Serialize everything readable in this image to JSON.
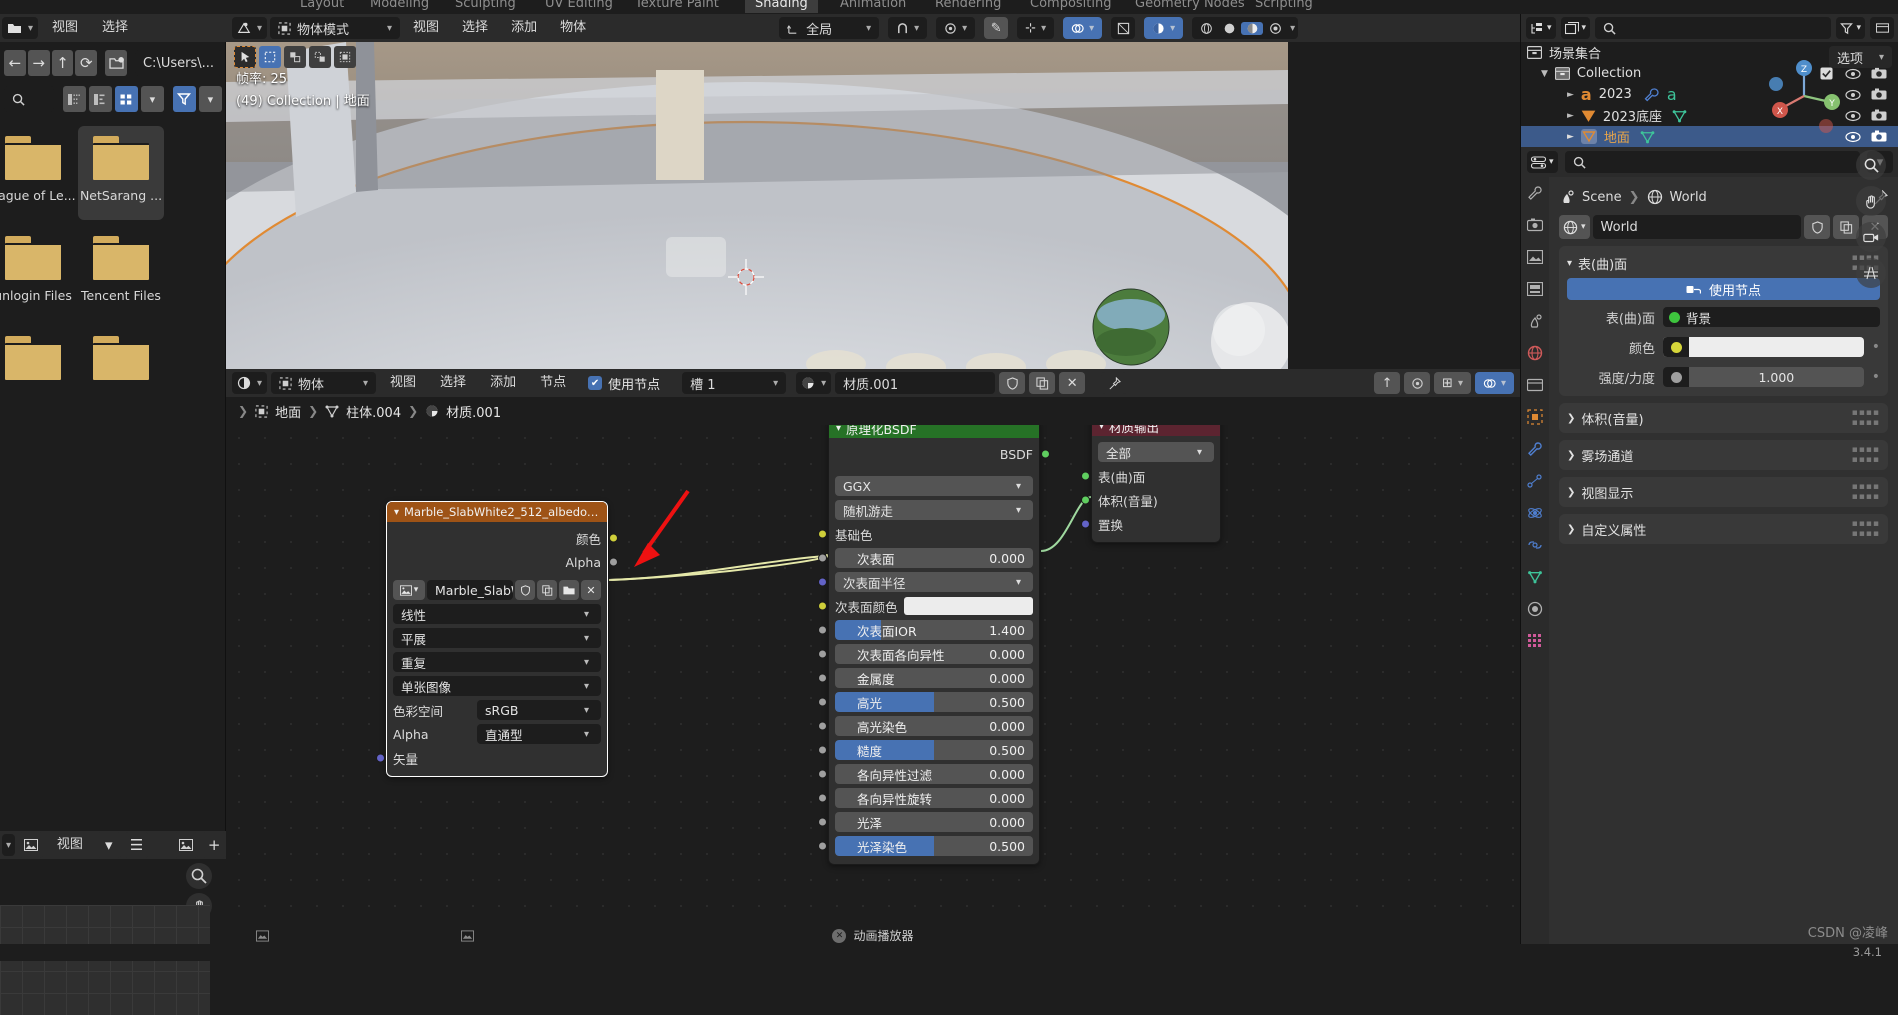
{
  "topbar": {
    "workspaces": [
      {
        "label": "Layout",
        "active": false
      },
      {
        "label": "Modeling",
        "active": false
      },
      {
        "label": "Sculpting",
        "active": false
      },
      {
        "label": "UV Editing",
        "active": false
      },
      {
        "label": "Texture Paint",
        "active": false
      },
      {
        "label": "Shading",
        "active": true
      },
      {
        "label": "Animation",
        "active": false
      },
      {
        "label": "Rendering",
        "active": false
      },
      {
        "label": "Compositing",
        "active": false
      },
      {
        "label": "Geometry Nodes",
        "active": false
      },
      {
        "label": "Scripting",
        "active": false
      }
    ]
  },
  "filebrowser": {
    "menus": [
      "视图",
      "选择"
    ],
    "path_value": "C:\\Users\\...",
    "search_placeholder": "",
    "icons": {
      "editor_type": "file-browser-icon",
      "back": "arrow-left-icon",
      "forward": "arrow-right-icon",
      "up": "arrow-up-icon",
      "refresh": "refresh-icon",
      "new_folder": "new-folder-icon",
      "search": "search-icon",
      "filter": "filter-icon",
      "display_list": "list-view-icon",
      "display_detail": "detail-view-icon",
      "display_thumbnail": "thumbnail-view-icon"
    },
    "items": [
      {
        "name": "eague of Le...",
        "selected": false
      },
      {
        "name": "NetSarang ...",
        "selected": true
      },
      {
        "name": "unlogin Files",
        "selected": false
      },
      {
        "name": "Tencent Files",
        "selected": false
      },
      {
        "name": "",
        "selected": false
      },
      {
        "name": "",
        "selected": false
      }
    ],
    "footer_menu": "视图"
  },
  "viewport": {
    "mode": "物体模式",
    "menus": [
      "视图",
      "选择",
      "添加",
      "物体"
    ],
    "transform_orientation": "全局",
    "overlay": {
      "fps_label": "帧率: 25",
      "scene_info": "(49) Collection | 地面"
    },
    "options_label": "选项",
    "gizmo_axes": {
      "x": "X",
      "y": "Y",
      "z": "Z"
    },
    "icons": {
      "editor_type": "3d-viewport-icon",
      "mode_icon": "object-mode-icon",
      "snap_magnet": "magnet-icon",
      "proportional_edit": "proportional-edit-icon",
      "overlays": "overlays-icon",
      "xray": "xray-icon",
      "shading_wireframe": "shading-wireframe-icon",
      "shading_solid": "shading-solid-icon",
      "shading_material": "shading-material-icon",
      "shading_rendered": "shading-rendered-icon",
      "zoom": "zoom-icon",
      "pan": "pan-hand-icon",
      "camera": "camera-view-icon",
      "grid": "grid-icon"
    }
  },
  "nodeeditor": {
    "shader_type": "物体",
    "menus": [
      "视图",
      "选择",
      "添加",
      "节点"
    ],
    "use_nodes_label": "使用节点",
    "use_nodes_checked": true,
    "slot_label": "槽 1",
    "material_name": "材质.001",
    "breadcrumb": [
      "地面",
      "柱体.004",
      "材质.001"
    ],
    "icons": {
      "editor_type": "shader-editor-icon",
      "shield": "shield-icon",
      "copy": "copy-icon",
      "close": "close-x-icon",
      "pin": "pin-icon",
      "snap": "snap-icon",
      "overlay": "overlay-icon"
    },
    "nodes": {
      "image_texture": {
        "title": "Marble_SlabWhite2_512_albedo.jpg",
        "header_color": "#9e5316",
        "outputs": [
          {
            "label": "颜色",
            "color": "#cfcf3a"
          },
          {
            "label": "Alpha",
            "color": "#9f9f9f"
          }
        ],
        "image_name": "Marble_SlabWhi...",
        "fields": [
          {
            "value": "线性"
          },
          {
            "value": "平展"
          },
          {
            "value": "重复"
          },
          {
            "value": "单张图像"
          }
        ],
        "labeled_fields": [
          {
            "label": "色彩空间",
            "value": "sRGB"
          },
          {
            "label": "Alpha",
            "value": "直通型"
          }
        ],
        "inputs": [
          {
            "label": "矢量",
            "color": "#6363c7"
          }
        ]
      },
      "principled_bsdf": {
        "title": "原理化BSDF",
        "header_color": "#267226",
        "output": {
          "label": "BSDF",
          "color": "#5fce5f"
        },
        "enum_fields": [
          "GGX",
          "随机游走"
        ],
        "rows": [
          {
            "kind": "socket-label",
            "label": "基础色",
            "color": "#cfcf3a"
          },
          {
            "kind": "slider",
            "label": "次表面",
            "value": "0.000",
            "fill": 0,
            "color": "#9f9f9f"
          },
          {
            "kind": "enum",
            "label": "次表面半径",
            "color": "#6363c7"
          },
          {
            "kind": "socket-swatch",
            "label": "次表面颜色",
            "color": "#cfcf3a",
            "swatch": "#ececec"
          },
          {
            "kind": "slider",
            "label": "次表面IOR",
            "value": "1.400",
            "fill": 23,
            "color": "#9f9f9f"
          },
          {
            "kind": "slider",
            "label": "次表面各向异性",
            "value": "0.000",
            "fill": 0,
            "color": "#9f9f9f"
          },
          {
            "kind": "slider",
            "label": "金属度",
            "value": "0.000",
            "fill": 0,
            "color": "#9f9f9f"
          },
          {
            "kind": "slider",
            "label": "高光",
            "value": "0.500",
            "fill": 50,
            "color": "#9f9f9f"
          },
          {
            "kind": "slider",
            "label": "高光染色",
            "value": "0.000",
            "fill": 0,
            "color": "#9f9f9f"
          },
          {
            "kind": "slider",
            "label": "糙度",
            "value": "0.500",
            "fill": 50,
            "color": "#9f9f9f"
          },
          {
            "kind": "slider",
            "label": "各向异性过滤",
            "value": "0.000",
            "fill": 0,
            "color": "#9f9f9f"
          },
          {
            "kind": "slider",
            "label": "各向异性旋转",
            "value": "0.000",
            "fill": 0,
            "color": "#9f9f9f"
          },
          {
            "kind": "slider",
            "label": "光泽",
            "value": "0.000",
            "fill": 0,
            "color": "#9f9f9f"
          },
          {
            "kind": "slider",
            "label": "光泽染色",
            "value": "0.500",
            "fill": 50,
            "color": "#9f9f9f"
          }
        ]
      },
      "material_output": {
        "title": "材质输出",
        "header_color": "#5c2430",
        "target": "全部",
        "inputs": [
          {
            "label": "表(曲)面",
            "color": "#5fce5f"
          },
          {
            "label": "体积(音量)",
            "color": "#5fce5f"
          },
          {
            "label": "置换",
            "color": "#6363c7"
          }
        ]
      }
    },
    "annotation_arrow": {
      "color": "#ee1111"
    }
  },
  "outliner": {
    "header_icons": {
      "display_mode": "outliner-display-icon",
      "filter_id": "id-type-icon",
      "search": "search-icon",
      "filter": "filter-icon",
      "new_collection": "new-collection-icon"
    },
    "root": "场景集合",
    "rows": [
      {
        "label": "Collection",
        "indent": 1,
        "icon": "collection-icon",
        "icon_color": "#c8c8c8",
        "selected": false,
        "has_checkbox": true,
        "expanded": true
      },
      {
        "label": "2023",
        "indent": 2,
        "icon": "font-object-icon",
        "icon_color": "#e08a33",
        "selected": false,
        "has_checkbox": false,
        "extra": [
          "modifier-wrench-icon",
          "font-data-icon"
        ]
      },
      {
        "label": "2023底座",
        "indent": 2,
        "icon": "mesh-object-icon",
        "icon_color": "#e08a33",
        "selected": false,
        "has_checkbox": false,
        "extra": [
          "mesh-data-icon"
        ]
      },
      {
        "label": "地面",
        "indent": 2,
        "icon": "mesh-object-icon",
        "icon_color": "#e08a33",
        "selected": true,
        "has_checkbox": false,
        "extra": [
          "mesh-data-icon"
        ]
      }
    ]
  },
  "properties": {
    "search_placeholder": "",
    "breadcrumb": [
      "Scene",
      "World"
    ],
    "datablock_name": "World",
    "tabs": [
      "tool-icon",
      "render-icon",
      "output-icon",
      "view-layer-icon",
      "scene-icon",
      "world-icon",
      "collection-icon",
      "object-icon",
      "modifier-icon",
      "particles-icon",
      "physics-icon",
      "constraints-icon",
      "data-icon",
      "material-icon",
      "texture-icon"
    ],
    "surface_panel": {
      "title": "表(曲)面",
      "use_nodes_label": "使用节点",
      "surface_label": "表(曲)面",
      "surface_value": "背景",
      "surface_dot": "#3ec43e",
      "color_label": "颜色",
      "color_dot": "#d6d63a",
      "strength_label": "强度/力度",
      "strength_value": "1.000",
      "strength_dot": "#9f9f9f"
    },
    "collapsed_panels": [
      "体积(音量)",
      "雾场通道",
      "视图显示",
      "自定义属性"
    ]
  },
  "statusbar": {
    "items": [],
    "player_label": "动画播放器",
    "watermark": "CSDN @凌峰",
    "version": "3.4.1"
  }
}
